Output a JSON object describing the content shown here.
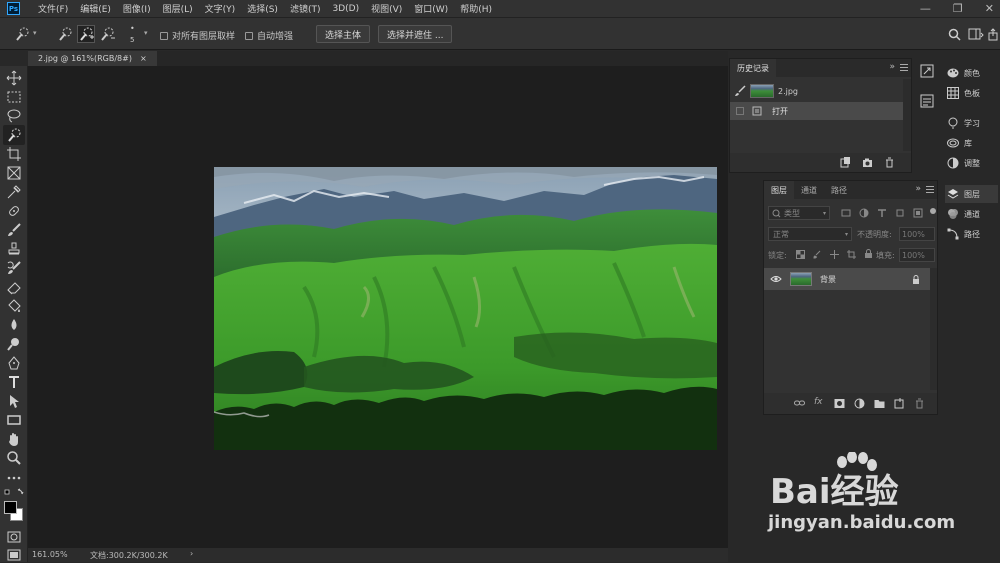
{
  "app": {
    "logo_text": "Ps"
  },
  "menu": [
    "文件(F)",
    "编辑(E)",
    "图像(I)",
    "图层(L)",
    "文字(Y)",
    "选择(S)",
    "滤镜(T)",
    "3D(D)",
    "视图(V)",
    "窗口(W)",
    "帮助(H)"
  ],
  "window_controls": {
    "minimize": "—",
    "restore": "❐",
    "close": "✕"
  },
  "options": {
    "brush_size": "5",
    "sample_all_layers": "对所有图层取样",
    "auto_enhance": "自动增强",
    "select_subject": "选择主体",
    "select_and_mask": "选择并遮住 ..."
  },
  "document": {
    "tab_title": "2.jpg @ 161%(RGB/8#)",
    "tab_close": "×"
  },
  "status": {
    "zoom": "161.05%",
    "doc_size": "文档:300.2K/300.2K",
    "arrow": "›"
  },
  "history": {
    "tab": "历史记录",
    "snapshot_label": "2.jpg",
    "items": [
      {
        "label": "打开"
      }
    ]
  },
  "layers_panel": {
    "tabs": [
      "图层",
      "通道",
      "路径"
    ],
    "filter_kind": "类型",
    "blend_mode": "正常",
    "opacity_label": "不透明度:",
    "opacity_value": "100%",
    "lock_label": "锁定:",
    "fill_label": "填充:",
    "fill_value": "100%",
    "layers": [
      {
        "name": "背景"
      }
    ],
    "footer_fx": "fx"
  },
  "side_panels": [
    {
      "label": "颜色",
      "icon": "palette-icon"
    },
    {
      "label": "色板",
      "icon": "swatches-icon"
    },
    {
      "label": "学习",
      "icon": "lightbulb-icon"
    },
    {
      "label": "库",
      "icon": "library-icon"
    },
    {
      "label": "调整",
      "icon": "adjustments-icon"
    },
    {
      "label": "图层",
      "icon": "layers-icon"
    },
    {
      "label": "通道",
      "icon": "channels-icon"
    },
    {
      "label": "路径",
      "icon": "paths-icon"
    }
  ],
  "watermark": {
    "brand": "Bai经验",
    "url": "jingyan.baidu.com"
  },
  "colors": {
    "ui_dark": "#323232",
    "canvas_bg": "#1e1e1e",
    "ps_blue": "#31a8ff"
  }
}
